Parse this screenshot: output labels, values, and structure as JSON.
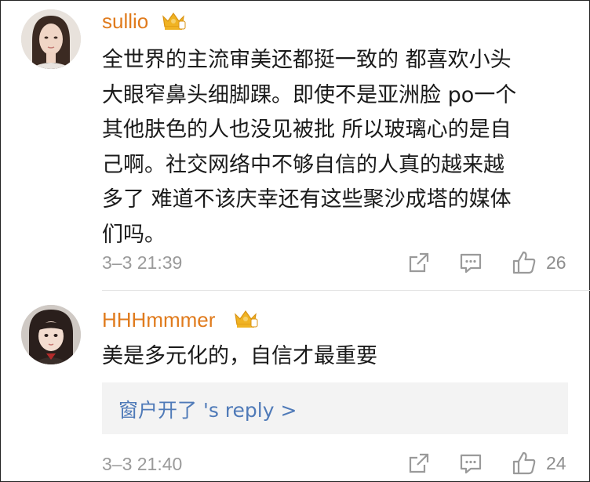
{
  "comments": [
    {
      "username": "sullio",
      "text_lines": [
        "全世界的主流审美还都挺一致的  都喜欢小头",
        "大眼窄鼻头细脚踝。即使不是亚洲脸  po一个",
        "其他肤色的人也没见被批  所以玻璃心的是自",
        "己啊。社交网络中不够自信的人真的越来越",
        "多了  难道不该庆幸还有这些聚沙成塔的媒体",
        "们吗。"
      ],
      "time": "3–3 21:39",
      "like_count": "26"
    },
    {
      "username": "HHHmmmer",
      "text_lines": [
        "美是多元化的，自信才最重要"
      ],
      "reply_preview": "窗户开了  's reply >",
      "time": "3–3 21:40",
      "like_count": "24"
    }
  ],
  "colors": {
    "username": "#e07b1d",
    "reply_link": "#4f7ab8",
    "meta": "#9a9a9a",
    "crown": "#f0b323"
  },
  "icons": [
    "crown-badge-icon",
    "share-icon",
    "comment-icon",
    "thumbs-up-icon"
  ]
}
